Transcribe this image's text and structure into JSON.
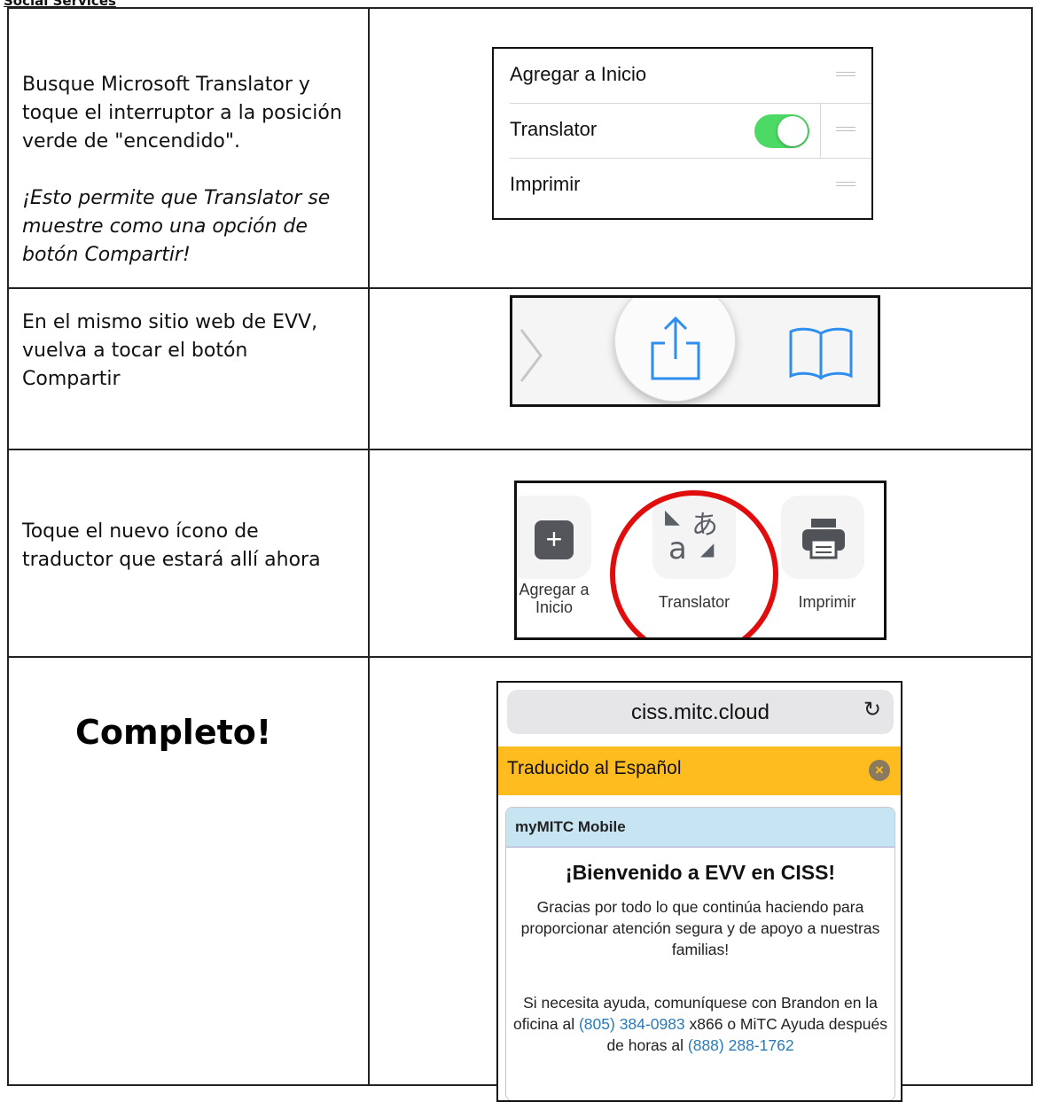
{
  "header_fragment": "Social Services",
  "rows": [
    {
      "instruction": "Busque Microsoft Translator y toque el interruptor a la posición verde de \"encendido\".",
      "note": "¡Esto permite que Translator se muestre como una opción de botón Compartir!",
      "settings_items": [
        "Agregar a Inicio",
        "Translator",
        "Imprimir"
      ]
    },
    {
      "instruction": "En el mismo sitio web de EVV, vuelva a tocar el botón Compartir"
    },
    {
      "instruction": "Toque el nuevo ícono de traductor que estará allí ahora",
      "tiles": [
        "Agregar a Inicio",
        "Translator",
        "Imprimir"
      ]
    },
    {
      "title": "Completo!"
    }
  ],
  "phone": {
    "url": "ciss.mitc.cloud",
    "banner": "Traducido al Español",
    "card_header": "myMITC Mobile",
    "welcome": "¡Bienvenido a EVV en CISS!",
    "para1": "Gracias por todo lo que continúa haciendo para proporcionar atención segura y de apoyo a nuestras familias!",
    "para2_a": "Si necesita ayuda, comuníquese con Brandon en la oficina al ",
    "phone1": "(805) 384-0983",
    "para2_b": " x866 o MiTC Ayuda después de horas al ",
    "phone2": "(888) 288-1762"
  },
  "colors": {
    "toggle_on": "#4cd964",
    "banner": "#ffbc1e",
    "share_blue": "#2d8ef0",
    "ring_red": "#e10d0d",
    "link": "#2a7ab8"
  }
}
